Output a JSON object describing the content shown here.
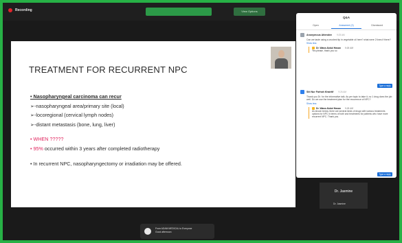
{
  "recording": {
    "label": "Recording"
  },
  "view_option": {
    "label": "View Options"
  },
  "slide": {
    "title": "TREATMENT FOR RECURRENT  NPC",
    "bullets": [
      "• Nasopharyngeal carcinoma can recur",
      "➢-nasopharyngeal area/primary site (local)",
      "➢-locoregional (cervical lymph nodes)",
      "➢-distant metastasis (bone, lung, liver)",
      "",
      "• WHEN ?????",
      "• 95% occurred within 3 years after completed radiotherapy",
      "",
      "• In recurrent NPC, nasopharyngectomy or irradiation may be offered."
    ]
  },
  "qa": {
    "title": "Q&A",
    "tabs": [
      "Open",
      "Answered (2)",
      "Dismissed"
    ],
    "questions": [
      {
        "asker": "Anonymous Attendee",
        "time": "9:25 AM",
        "text": "Can we taste using a crushed tip in vegetable oil here? what were 2 lines if there?",
        "link": "Show less",
        "answer_name": "Dr. Wana Abdul Hasan",
        "answer_time": "9:26 AM",
        "answer_text": "Yes please, thank you so ",
        "reply": "Type a reply"
      },
      {
        "asker": "Siti Nur Farhah Khairtif",
        "time": "9:26 AM",
        "text": "Thank you Dr. for the informative talk. As per topic to take it, no 1 drug does the job well. Do we use the treatment plan for the recurrence of NPC?",
        "link": "Show less",
        "answer_name": "Dr. Wana Abdul Hasan",
        "answer_time": "9:28 AM",
        "answer_text": "As shown below, there are several kinds of drugs with various treatments options for NPC in terms of both and treatments for patients who have more recurrent NPC. Thank you.",
        "reply": "Type a reply"
      }
    ]
  },
  "participant": {
    "label": "Dr. Jasmine",
    "name": "Dr. Jasmine"
  },
  "notification": {
    "line1": "From ADAM MEDICAL to Everyone",
    "line2": "Good afternoon"
  }
}
